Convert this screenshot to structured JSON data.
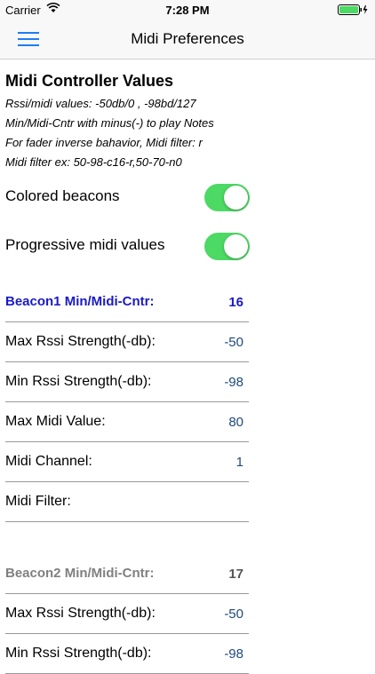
{
  "status_bar": {
    "carrier": "Carrier",
    "time": "7:28 PM",
    "wifi_icon": "wifi-icon",
    "battery_icon": "battery-charging-icon"
  },
  "nav": {
    "title": "Midi Preferences",
    "menu_icon": "hamburger-menu-icon",
    "accent": "#1a7ef5"
  },
  "section": {
    "title": "Midi Controller Values",
    "info_lines": [
      "Rssi/midi values: -50db/0 , -98bd/127",
      "Min/Midi-Cntr with minus(-) to play Notes",
      "For fader inverse bahavior, Midi filter: r",
      "Midi filter ex: 50-98-c16-r,50-70-n0"
    ]
  },
  "switches": [
    {
      "label": "Colored beacons",
      "on": true
    },
    {
      "label": "Progressive midi values",
      "on": true
    }
  ],
  "switch_color": "#4cd964",
  "beacon1": {
    "header_label": "Beacon1 Min/Midi-Cntr:",
    "header_value": "16",
    "header_color": "#1a1ac8",
    "rows": [
      {
        "label": "Max Rssi Strength(-db):",
        "value": "-50"
      },
      {
        "label": "Min Rssi Strength(-db):",
        "value": "-98"
      },
      {
        "label": "Max Midi Value:",
        "value": "80"
      },
      {
        "label": "Midi Channel:",
        "value": "1"
      },
      {
        "label": "Midi Filter:",
        "value": ""
      }
    ]
  },
  "beacon2": {
    "header_label": "Beacon2 Min/Midi-Cntr:",
    "header_value": "17",
    "header_color": "#808080",
    "rows": [
      {
        "label": "Max Rssi Strength(-db):",
        "value": "-50"
      },
      {
        "label": "Min Rssi Strength(-db):",
        "value": "-98"
      }
    ]
  }
}
